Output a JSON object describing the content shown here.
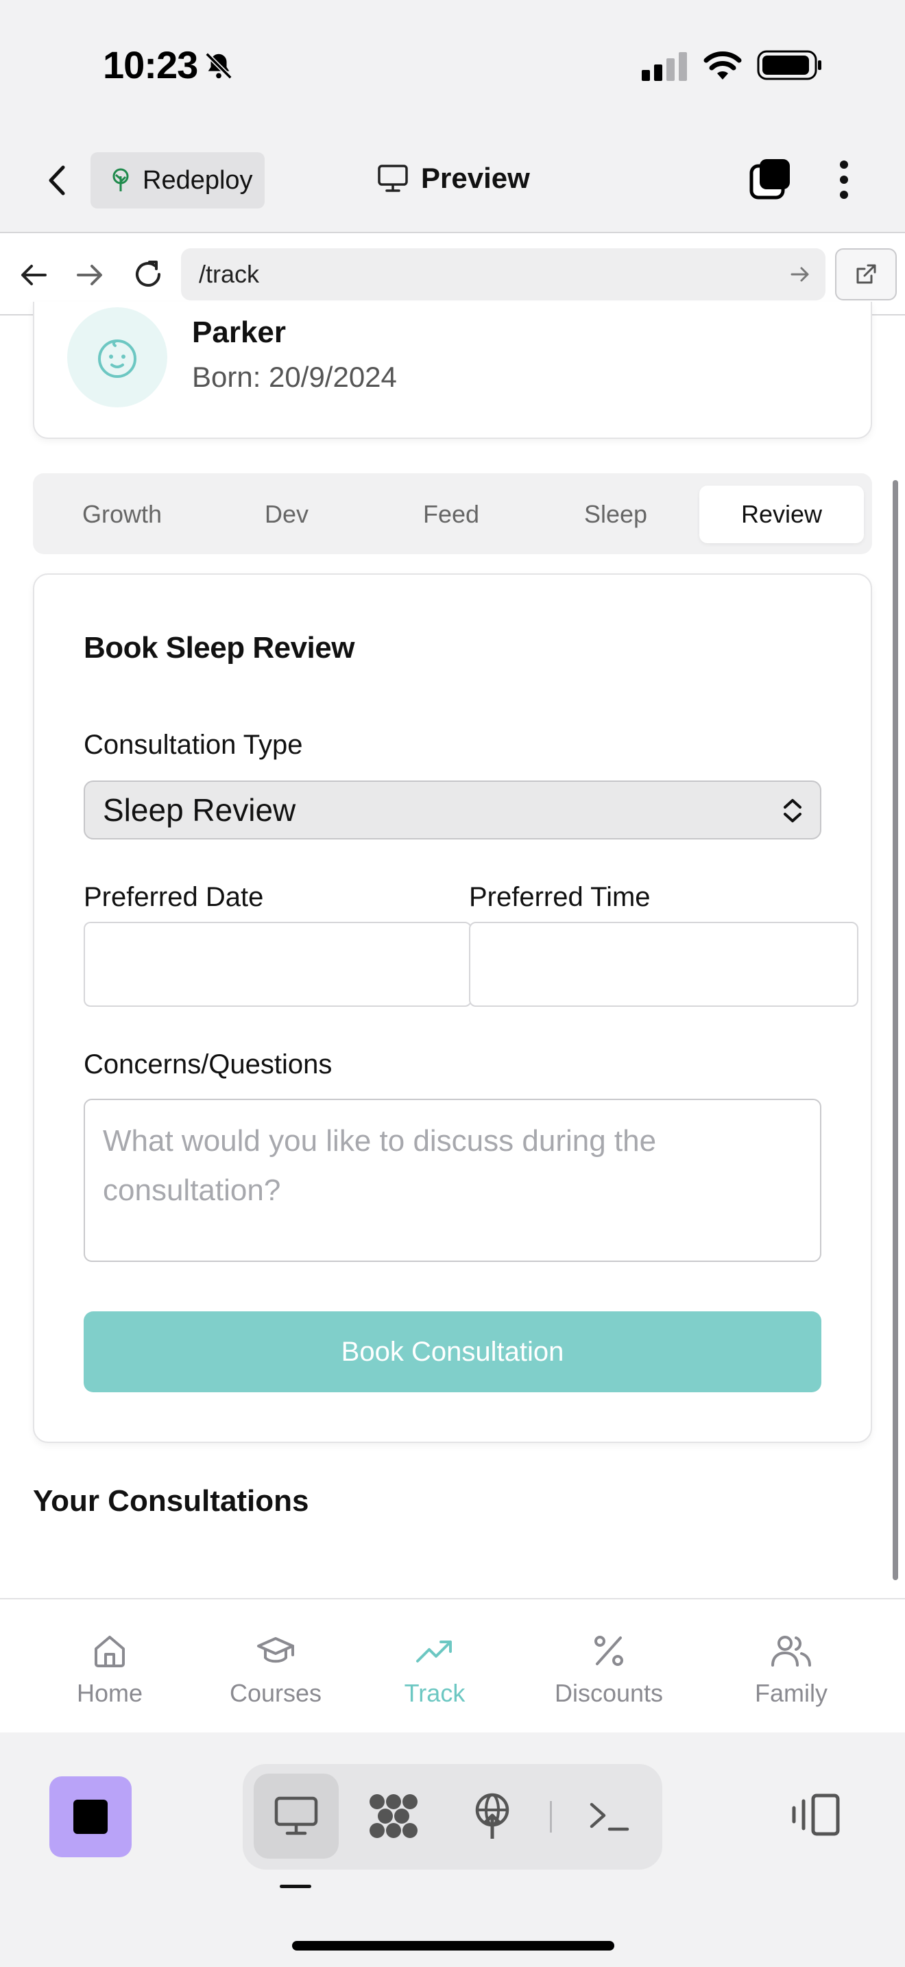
{
  "status_bar": {
    "time": "10:23"
  },
  "header": {
    "back_label": "Back",
    "project_chip": "Redeploy",
    "title": "Preview"
  },
  "browser": {
    "url": "/track"
  },
  "profile": {
    "name": "Parker",
    "born": "Born: 20/9/2024"
  },
  "tabs": [
    {
      "label": "Growth",
      "active": false
    },
    {
      "label": "Dev",
      "active": false
    },
    {
      "label": "Feed",
      "active": false
    },
    {
      "label": "Sleep",
      "active": false
    },
    {
      "label": "Review",
      "active": true
    }
  ],
  "form": {
    "title": "Book Sleep Review",
    "consultation_type_label": "Consultation Type",
    "consultation_type_value": "Sleep Review",
    "preferred_date_label": "Preferred Date",
    "preferred_date_value": "",
    "preferred_time_label": "Preferred Time",
    "preferred_time_value": "",
    "concerns_label": "Concerns/Questions",
    "concerns_placeholder": "What would you like to discuss during the consultation?",
    "submit_label": "Book Consultation"
  },
  "consultations": {
    "title": "Your Consultations"
  },
  "bottom_nav": [
    {
      "label": "Home",
      "icon": "home-icon",
      "active": false
    },
    {
      "label": "Courses",
      "icon": "graduation-cap-icon",
      "active": false
    },
    {
      "label": "Track",
      "icon": "trending-up-icon",
      "active": true
    },
    {
      "label": "Discounts",
      "icon": "percent-icon",
      "active": false
    },
    {
      "label": "Family",
      "icon": "users-icon",
      "active": false
    }
  ],
  "colors": {
    "accent": "#80cfca",
    "accent_text": "#6cc7c2",
    "stop_button": "#b9a3f8"
  }
}
